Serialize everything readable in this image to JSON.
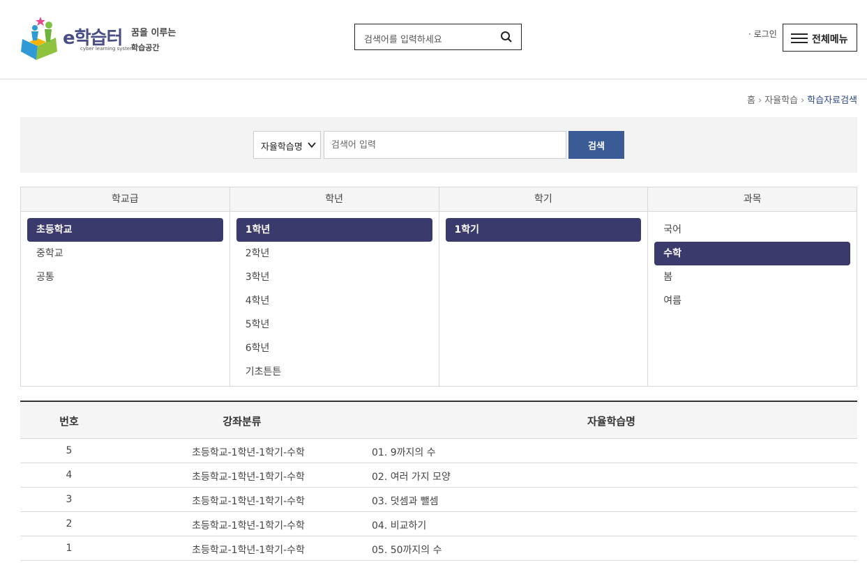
{
  "header": {
    "logo_text": "e학습터",
    "logo_subtext": "cyber learning system",
    "logo_tagline_1": "꿈을 이루는",
    "logo_tagline_2": "학습공간",
    "search_placeholder": "검색어를 입력하세요",
    "login_label": "· 로그인",
    "menu_label": "전체메뉴"
  },
  "breadcrumb": [
    "홈",
    "자율학습",
    "학습자료검색"
  ],
  "search": {
    "select_value": "자율학습명",
    "input_placeholder": "검색어 입력",
    "button_label": "검색"
  },
  "filters": {
    "school": {
      "header": "학교급",
      "options": [
        "초등학교",
        "중학교",
        "공통"
      ],
      "selected": "초등학교"
    },
    "grade": {
      "header": "학년",
      "options": [
        "1학년",
        "2학년",
        "3학년",
        "4학년",
        "5학년",
        "6학년",
        "기초튼튼"
      ],
      "selected": "1학년"
    },
    "semester": {
      "header": "학기",
      "options": [
        "1학기"
      ],
      "selected": "1학기"
    },
    "subject": {
      "header": "과목",
      "options": [
        "국어",
        "수학",
        "봄",
        "여름"
      ],
      "selected": "수학"
    }
  },
  "table": {
    "headers": {
      "no": "번호",
      "category": "강좌분류",
      "name": "자율학습명"
    },
    "rows": [
      {
        "no": "5",
        "category": "초등학교-1학년-1학기-수학",
        "name": "01. 9까지의 수"
      },
      {
        "no": "4",
        "category": "초등학교-1학년-1학기-수학",
        "name": "02. 여러 가지 모양"
      },
      {
        "no": "3",
        "category": "초등학교-1학년-1학기-수학",
        "name": "03. 덧셈과 뺄셈"
      },
      {
        "no": "2",
        "category": "초등학교-1학년-1학기-수학",
        "name": "04. 비교하기"
      },
      {
        "no": "1",
        "category": "초등학교-1학년-1학기-수학",
        "name": "05. 50까지의 수"
      }
    ]
  },
  "colors": {
    "accent": "#3b3a6c",
    "button": "#3a5b96",
    "breadcrumb_current": "#2b4a8c"
  }
}
